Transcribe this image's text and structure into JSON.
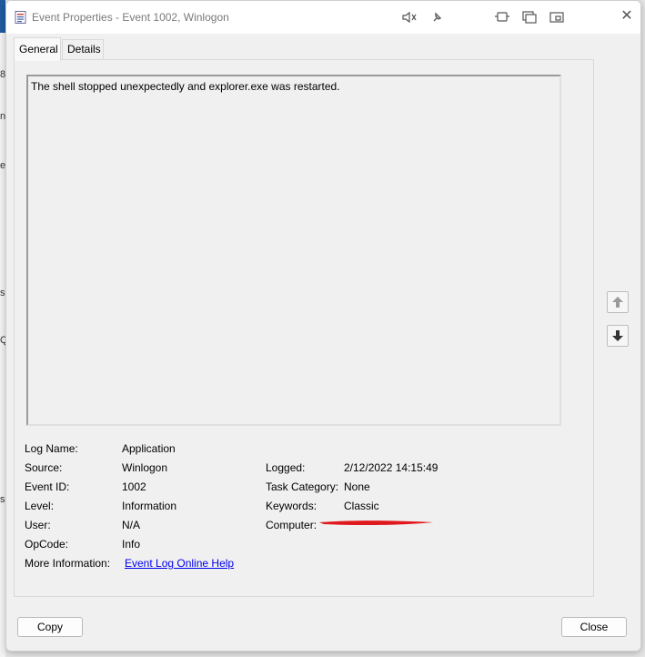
{
  "window": {
    "title": "Event Properties - Event 1002, Winlogon",
    "close_glyph": "✕"
  },
  "tabs": [
    {
      "label": "General",
      "active": true
    },
    {
      "label": "Details",
      "active": false
    }
  ],
  "description": "The shell stopped unexpectedly and explorer.exe was restarted.",
  "fields": {
    "log_name": {
      "label": "Log Name:",
      "value": "Application"
    },
    "source": {
      "label": "Source:",
      "value": "Winlogon"
    },
    "event_id": {
      "label": "Event ID:",
      "value": "1002"
    },
    "level": {
      "label": "Level:",
      "value": "Information"
    },
    "user": {
      "label": "User:",
      "value": "N/A"
    },
    "opcode": {
      "label": "OpCode:",
      "value": "Info"
    },
    "more_info": {
      "label": "More Information:",
      "value": "Event Log Online Help"
    },
    "logged": {
      "label": "Logged:",
      "value": "2/12/2022 14:15:49"
    },
    "task_category": {
      "label": "Task Category:",
      "value": "None"
    },
    "keywords": {
      "label": "Keywords:",
      "value": "Classic"
    },
    "computer": {
      "label": "Computer:"
    }
  },
  "buttons": {
    "copy": "Copy",
    "close": "Close"
  },
  "colors": {
    "redaction": "#e0191f",
    "link": "#0000ee"
  },
  "background_fragments": [
    "8",
    "n",
    "e",
    "s",
    "Q",
    "s"
  ]
}
